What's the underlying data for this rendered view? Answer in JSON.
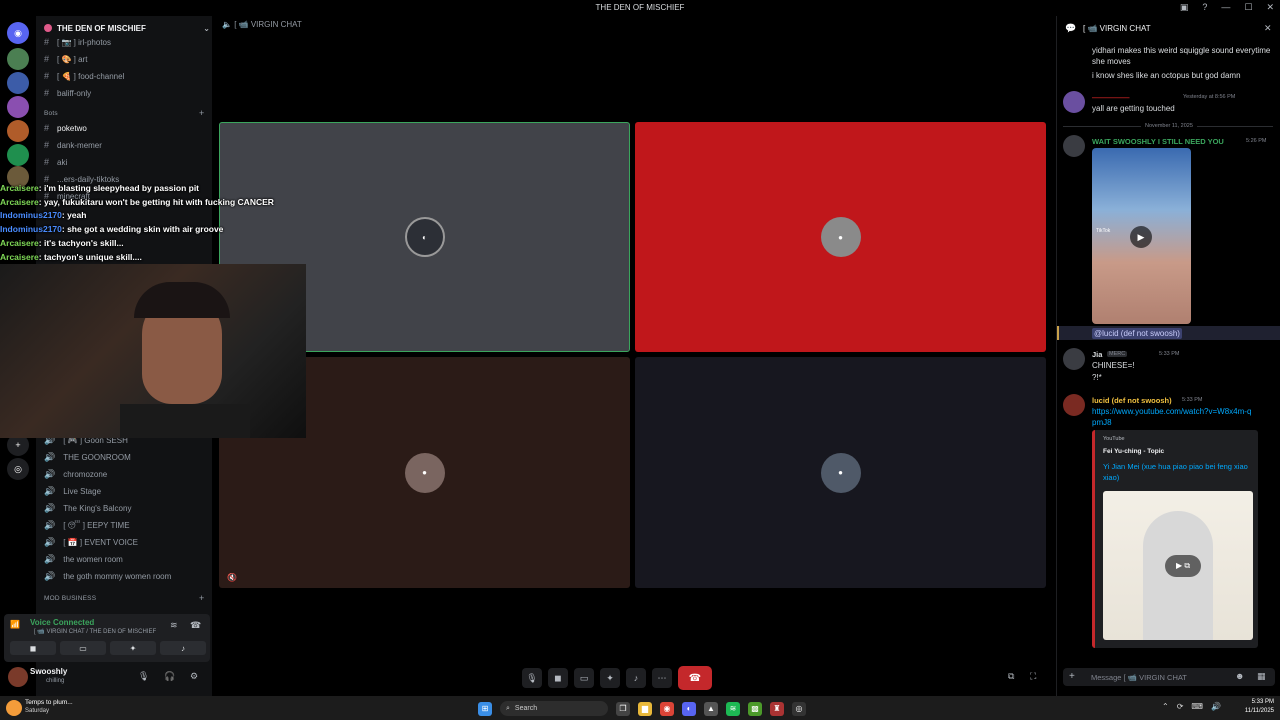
{
  "window": {
    "title": "THE DEN OF MISCHIEF"
  },
  "server": {
    "name": "THE DEN OF MISCHIEF"
  },
  "channels_top": [
    {
      "prefix": "#",
      "label": "[ 📷 ] irl-photos"
    },
    {
      "prefix": "#",
      "label": "[ 🎨 ] art"
    },
    {
      "prefix": "#",
      "label": "[ 🍕 ] food-channel"
    },
    {
      "prefix": "#",
      "label": "baliff-only"
    }
  ],
  "bots_category": "Bots",
  "bot_channels": [
    {
      "prefix": "#",
      "label": "poketwo"
    },
    {
      "prefix": "#",
      "label": "dank-memer"
    },
    {
      "prefix": "#",
      "label": "aki"
    },
    {
      "prefix": "#",
      "label": "...ers-daily-tiktoks"
    },
    {
      "prefix": "#",
      "label": "minecraft"
    }
  ],
  "voice_channels": [
    {
      "label": "[ 🎮 ] Goon SESH"
    },
    {
      "label": "THE GOONROOM"
    },
    {
      "label": "chromozone"
    },
    {
      "label": "Live Stage"
    },
    {
      "label": "The King's Balcony"
    },
    {
      "label": "[ 😴 ] EEPY TIME"
    },
    {
      "label": "[ 📅 ] EVENT VOICE"
    },
    {
      "label": "the women room"
    },
    {
      "label": "the goth mommy women room"
    }
  ],
  "mod_category": "MOD BUSINESS",
  "voice_status": {
    "label": "Voice Connected",
    "location": "[ 📹 VIRGIN CHAT / THE DEN OF MISCHIEF"
  },
  "user": {
    "name": "Swooshly",
    "status": "chilling"
  },
  "main": {
    "channel": "[ 📹 VIRGIN CHAT"
  },
  "overlay_chat": [
    {
      "user": "Arcaisere",
      "color": "#7fd957",
      "text": ": i'm blasting sleepyhead by passion pit"
    },
    {
      "user": "Arcaisere",
      "color": "#7fd957",
      "text": ": yay, fukukitaru won't be getting hit with fucking CANCER"
    },
    {
      "user": "Indominus2170",
      "color": "#4a8cff",
      "text": ": yeah"
    },
    {
      "user": "Indominus2170",
      "color": "#4a8cff",
      "text": ": she got a wedding skin with air groove"
    },
    {
      "user": "Arcaisere",
      "color": "#7fd957",
      "text": ": it's tachyon's skill..."
    },
    {
      "user": "Arcaisere",
      "color": "#7fd957",
      "text": ": tachyon's unique skill...."
    }
  ],
  "chat": {
    "title": "[ 📹 VIRGIN CHAT",
    "input_placeholder": "Message  [ 📹 VIRGIN CHAT",
    "lines_top": [
      "yidhari makes this weird squiggle sound everytime she moves",
      "i know shes like an octopus but god damn"
    ],
    "msg1": {
      "user": "—————",
      "time": "Yesterday at 8:56 PM",
      "text": "yall are getting touched"
    },
    "divider": "November 11, 2025",
    "msg2": {
      "user": "WAIT SWOOSHLY I STILL NEED YOU",
      "time": "5:26 PM",
      "video_label": "TikTok",
      "mention": "@lucid (def not swoosh)"
    },
    "msg3": {
      "user": "Jia",
      "badge": "MERC",
      "time": "5:33 PM",
      "lines": [
        "CHINESE=!",
        "?!*"
      ]
    },
    "msg4": {
      "user": "lucid (def not swoosh)",
      "time": "5:33 PM",
      "link": "https://www.youtube.com/watch?v=W8x4m-qpmJ8",
      "embed": {
        "provider": "YouTube",
        "author": "Fei Yu-ching - Topic",
        "title": "Yi Jian Mei (xue hua piao piao bei feng xiao xiao)"
      }
    }
  },
  "taskbar": {
    "weather_temp": "Temps to plum...",
    "weather_day": "Saturday",
    "search": "Search",
    "time": "5:33 PM",
    "date": "11/11/2025"
  },
  "colors": {
    "accent": "#5865f2",
    "tile_red": "#c0171b",
    "tile_gray": "#414349",
    "tile_brown": "#2b1b17",
    "tile_navy": "#17171f",
    "speaking": "#3ba55d",
    "hangup": "#c4282b"
  }
}
